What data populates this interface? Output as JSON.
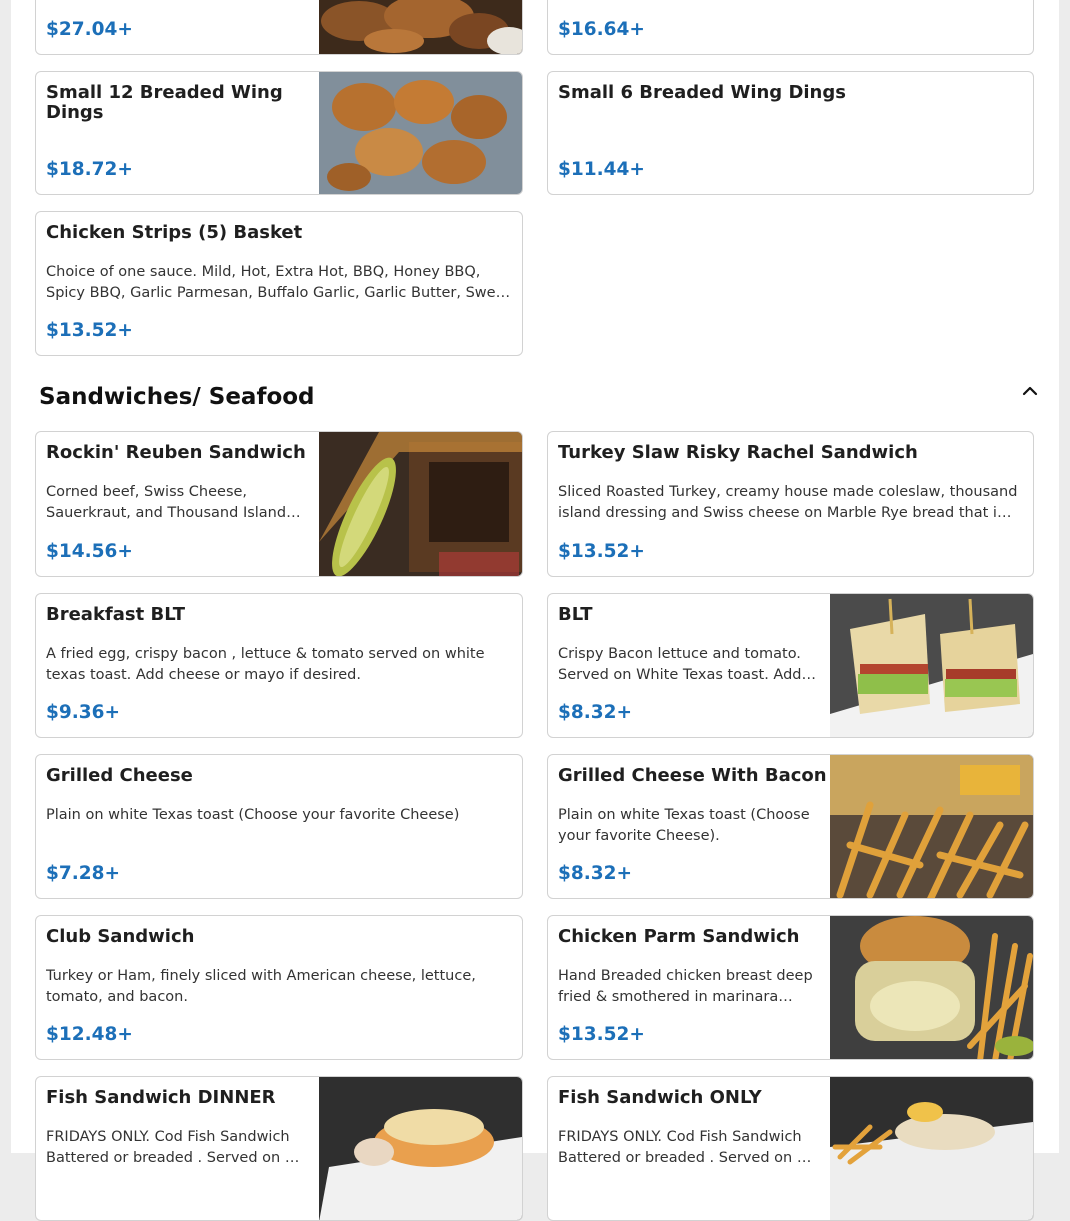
{
  "section": {
    "title": "Sandwiches/ Seafood"
  },
  "items": [
    {
      "name": "",
      "desc": "",
      "price": "$27.04+"
    },
    {
      "name": "",
      "desc": "",
      "price": "$16.64+"
    },
    {
      "name": "Small 12 Breaded Wing Dings",
      "desc": "",
      "price": "$18.72+"
    },
    {
      "name": "Small 6 Breaded Wing Dings",
      "desc": "",
      "price": "$11.44+"
    },
    {
      "name": "Chicken Strips (5) Basket",
      "desc": "Choice of one sauce. Mild, Hot, Extra Hot, BBQ, Honey BBQ, Spicy BBQ, Garlic Parmesan, Buffalo Garlic, Garlic Butter, Sweet Teriyaki",
      "price": "$13.52+"
    },
    {
      "name": "Rockin' Reuben Sandwich",
      "desc": "Corned beef, Swiss Cheese, Sauerkraut, and Thousand Island dressing",
      "price": "$14.56+"
    },
    {
      "name": "Turkey Slaw Risky Rachel Sandwich",
      "desc": "Sliced Roasted Turkey, creamy house made coleslaw, thousand island dressing and Swiss cheese on Marble Rye bread that is grilled",
      "price": "$13.52+"
    },
    {
      "name": "Breakfast BLT",
      "desc": "A fried egg, crispy bacon , lettuce & tomato served on white texas toast. Add cheese or mayo if desired.",
      "price": "$9.36+"
    },
    {
      "name": "BLT",
      "desc": "Crispy Bacon lettuce and tomato. Served on White Texas toast. Add cheese",
      "price": "$8.32+"
    },
    {
      "name": "Grilled Cheese",
      "desc": "Plain on white Texas toast (Choose your favorite Cheese)",
      "price": "$7.28+"
    },
    {
      "name": "Grilled Cheese With Bacon",
      "desc": "Plain on white Texas toast (Choose your favorite Cheese).",
      "price": "$8.32+"
    },
    {
      "name": "Club Sandwich",
      "desc": "Turkey or Ham, finely sliced with American cheese, lettuce, tomato, and bacon.",
      "price": "$12.48+"
    },
    {
      "name": "Chicken Parm Sandwich",
      "desc": "Hand Breaded chicken breast deep fried & smothered in marinara sauce",
      "price": "$13.52+"
    },
    {
      "name": "Fish Sandwich DINNER",
      "desc": "FRIDAYS ONLY. Cod Fish Sandwich Battered or breaded . Served on a bun",
      "price": ""
    },
    {
      "name": "Fish Sandwich ONLY",
      "desc": "FRIDAYS ONLY. Cod Fish Sandwich Battered or breaded . Served on a bun",
      "price": ""
    }
  ],
  "icons": {
    "collapse": "chevron-up-icon"
  },
  "colors": {
    "price": "#1c6fb8",
    "border": "#d2d2d2"
  }
}
